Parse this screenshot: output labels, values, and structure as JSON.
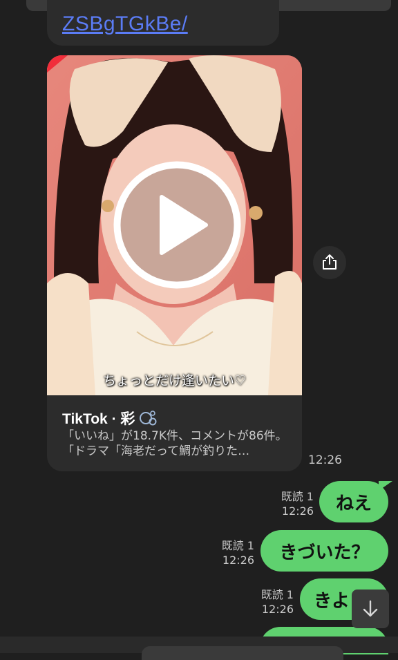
{
  "link_message": {
    "text": "ZSBgTGkBe/"
  },
  "tiktok_card": {
    "caption": "ちょっとだけ逢いたい♡",
    "title": "TikTok · 彩",
    "icon": "soap-bubbles-icon",
    "description": "「いいね」が18.7K件、コメントが86件。「ドラマ「海老だって鯛が釣りた…",
    "time": "12:26"
  },
  "messages": [
    {
      "read": "既読 1",
      "time": "12:26",
      "text": "ねえ"
    },
    {
      "read": "既読 1",
      "time": "12:26",
      "text": "きづいた？"
    },
    {
      "read": "既読 1",
      "time": "12:26",
      "text": "きよ"
    }
  ],
  "icons": {
    "play": "play-icon",
    "share": "share-icon",
    "scroll": "arrow-down-icon"
  },
  "colors": {
    "background": "#1f1f1f",
    "bubble_in": "#2c2c2c",
    "bubble_out": "#5fd16f",
    "link": "#5b7cf5"
  }
}
